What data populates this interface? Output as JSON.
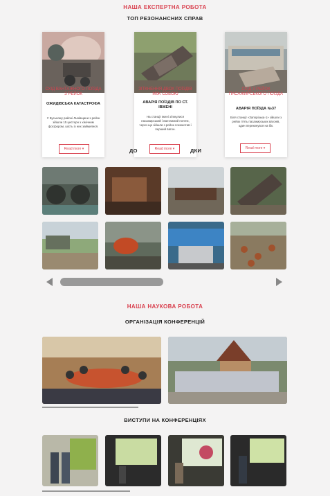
{
  "expert": {
    "section_title": "НАША ЕКСПЕРТНА РОБОТА",
    "top_title": "ТОП РЕЗОНАНСНИХ СПРАВ",
    "cards": [
      {
        "category": "СХІД ВАНТАЖНОГО ПОЇЗДА З РЕЙОК",
        "title": "ОЖИДІВСЬКА КАТАСТРОФА",
        "text": "У Буському районі Львівщини з рейок зійшли 15 цистерн з хімічним фосфором, шість із них займилися.",
        "button": "Read more"
      },
      {
        "category": "ЗІТКНЕННЯ ДВОХ ПОЇЗДІВ МІЖ СОБОЮ",
        "title": "АВАРІЯ ПОЇЗДІВ ПО СТ. ІВЖЕНІ",
        "text": "На станції Іжені зіткнулися пасажирський і вантажний потяги, через що зійшли з рейок локомотив і перший вагон.",
        "button": "Read more"
      },
      {
        "category": "СХІД З РЕЙОК ПАСАЖИРСЬКОГО ПОЇЗДА",
        "title": "АВАРІЯ ПОЇЗДА №37",
        "text": "Біля станції «Запорізька-1» зійшли з рейок п'ять пасажирських вагонів, один перекинувся на бік.",
        "button": "Read more"
      }
    ],
    "gallery_title_left": "ДО",
    "gallery_title_right": "ДКИ"
  },
  "science": {
    "section_title": "НАША НАУКОВА РОБОТА",
    "conf_title": "ОРГАНІЗАЦІЯ КОНФЕРЕНЦІЙ",
    "talks_title": "ВИСТУПИ НА КОНФЕРЕНЦІЯХ"
  },
  "colors": {
    "accent": "#d9414f",
    "background": "#f4f3f3"
  }
}
